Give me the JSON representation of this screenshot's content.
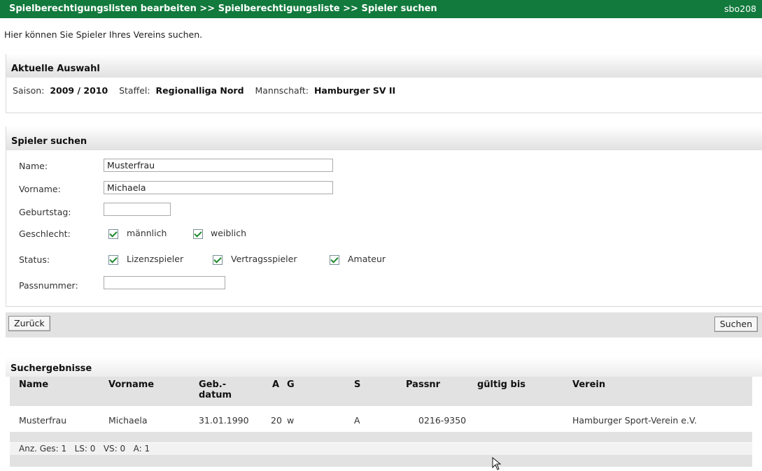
{
  "header": {
    "breadcrumb": "Spielberechtigungslisten bearbeiten >> Spielberechtigungsliste >> Spieler suchen",
    "code": "sbo208"
  },
  "intro": "Hier können Sie Spieler Ihres Vereins suchen.",
  "selection": {
    "title": "Aktuelle Auswahl",
    "saison_label": "Saison:",
    "saison_value": "2009 / 2010",
    "staffel_label": "Staffel:",
    "staffel_value": "Regionalliga Nord",
    "mannschaft_label": "Mannschaft:",
    "mannschaft_value": "Hamburger SV II"
  },
  "search": {
    "title": "Spieler suchen",
    "name_label": "Name:",
    "name_value": "Musterfrau",
    "vorname_label": "Vorname:",
    "vorname_value": "Michaela",
    "geburtstag_label": "Geburtstag:",
    "geburtstag_value": "",
    "geschlecht_label": "Geschlecht:",
    "geschlecht_options": [
      {
        "label": "männlich",
        "checked": true
      },
      {
        "label": "weiblich",
        "checked": true
      }
    ],
    "status_label": "Status:",
    "status_options": [
      {
        "label": "Lizenzspieler",
        "checked": true
      },
      {
        "label": "Vertragsspieler",
        "checked": true
      },
      {
        "label": "Amateur",
        "checked": true
      }
    ],
    "passnummer_label": "Passnummer:",
    "passnummer_value": ""
  },
  "buttons": {
    "back": "Zurück",
    "search": "Suchen"
  },
  "results": {
    "title": "Suchergebnisse",
    "columns": [
      "Name",
      "Vorname",
      "Geb.-\ndatum",
      "A",
      "G",
      "S",
      "Passnr",
      "gültig bis",
      "Verein"
    ],
    "rows": [
      [
        "Musterfrau",
        "Michaela",
        "31.01.1990",
        "20",
        "w",
        "A",
        "0216-9350",
        "",
        "Hamburger Sport-Verein e.V."
      ]
    ],
    "summary": "Anz. Ges: 1   LS: 0   VS: 0   A: 1"
  },
  "icons": {
    "checkbox": "checkbox-checked-icon",
    "cursor": "mouse-pointer-icon"
  },
  "colors": {
    "header_bg": "#117a3c",
    "check": "#1d8a2e"
  }
}
